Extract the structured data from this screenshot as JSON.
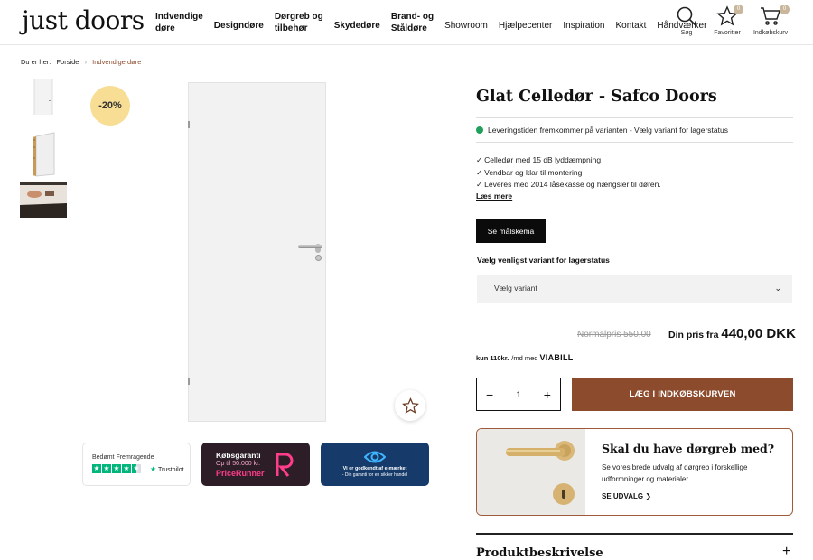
{
  "header": {
    "logo": "just doors",
    "nav": [
      {
        "lines": [
          "Indvendige",
          "døre"
        ],
        "bold": true
      },
      {
        "lines": [
          "Designdøre"
        ],
        "bold": true
      },
      {
        "lines": [
          "Dørgreb og",
          "tilbehør"
        ],
        "bold": true
      },
      {
        "lines": [
          "Skydedøre"
        ],
        "bold": true
      },
      {
        "lines": [
          "Brand- og",
          "Ståldøre"
        ],
        "bold": true
      },
      {
        "lines": [
          "Showroom"
        ],
        "bold": false
      },
      {
        "lines": [
          "Hjælpecenter"
        ],
        "bold": false
      },
      {
        "lines": [
          "Inspiration"
        ],
        "bold": false
      },
      {
        "lines": [
          "Kontakt"
        ],
        "bold": false
      },
      {
        "lines": [
          "Håndværker"
        ],
        "bold": false
      }
    ],
    "search_label": "Søg",
    "favorites_label": "Favoritter",
    "favorites_count": "0",
    "cart_label": "Indkøbskurv",
    "cart_count": "0"
  },
  "breadcrumb": {
    "prefix": "Du er her:",
    "home": "Forside",
    "sep": "›",
    "current": "Indvendige døre"
  },
  "gallery": {
    "discount": "-20%"
  },
  "trust": {
    "trustpilot_rating": "Bedømt Fremragende",
    "trustpilot_logo": "Trustpilot",
    "pr_line1": "Købsgaranti",
    "pr_line2": "Op til 50.000 kr.",
    "pr_line3": "PriceRunner",
    "em_line1": "Vi er godkendt af e-mærket",
    "em_line2": "- Din garanti for en sikker handel"
  },
  "product": {
    "title": "Glat Celledør - Safco Doors",
    "stock_text": "Leveringstiden fremkommer på varianten - Vælg variant for lagerstatus",
    "features": [
      "Celledør med 15 dB lyddæmpning",
      "Vendbar og klar til montering",
      "Leveres med 2014 låsekasse og hængsler til døren."
    ],
    "read_more": "Læs mere",
    "measure_button": "Se målskema",
    "variant_label": "Vælg venligst variant for lagerstatus",
    "variant_placeholder": "Vælg variant",
    "normal_price": "Normalpris 550,00",
    "price_prefix": "Din pris fra",
    "price": "440,00 DKK",
    "viabill_amount": "kun 110kr.",
    "viabill_text": "/md med",
    "viabill_logo": "VIABILL",
    "quantity": "1",
    "add_to_cart": "LÆG I INDKØBSKURVEN",
    "status_color": "#20a05a",
    "accent_color": "#8b4b2c"
  },
  "promo": {
    "title": "Skal du have dørgreb med?",
    "text": "Se vores brede udvalg af dørgreb i forskellige udformninger og materialer",
    "link": "SE UDVALG"
  },
  "description": {
    "title": "Produktbeskrivelse",
    "toggle": "+"
  }
}
